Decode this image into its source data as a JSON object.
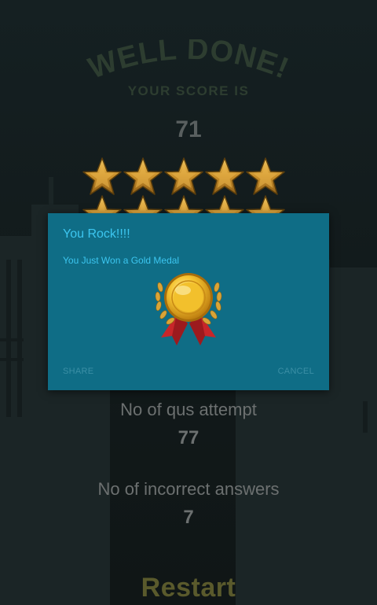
{
  "game": {
    "title": "WELL DONE!",
    "subtitle": "YOUR SCORE IS",
    "score": "71",
    "stars_earned": 5,
    "stats": [
      {
        "label": "No of qus attempt",
        "value": "77"
      },
      {
        "label": "No of incorrect answers",
        "value": "7"
      }
    ],
    "restart_label": "Restart"
  },
  "dialog": {
    "title": "You Rock!!!!",
    "message": "You Just Won a Gold Medal",
    "icon": "gold-medal-icon",
    "share_label": "SHARE",
    "cancel_label": "CANCEL"
  },
  "colors": {
    "dialog_bg": "#0f6d86",
    "dialog_text": "#3cc6f0",
    "title_text": "#2d3d30",
    "restart_text": "#5a5a2c",
    "star_gold": "#d9a437"
  }
}
